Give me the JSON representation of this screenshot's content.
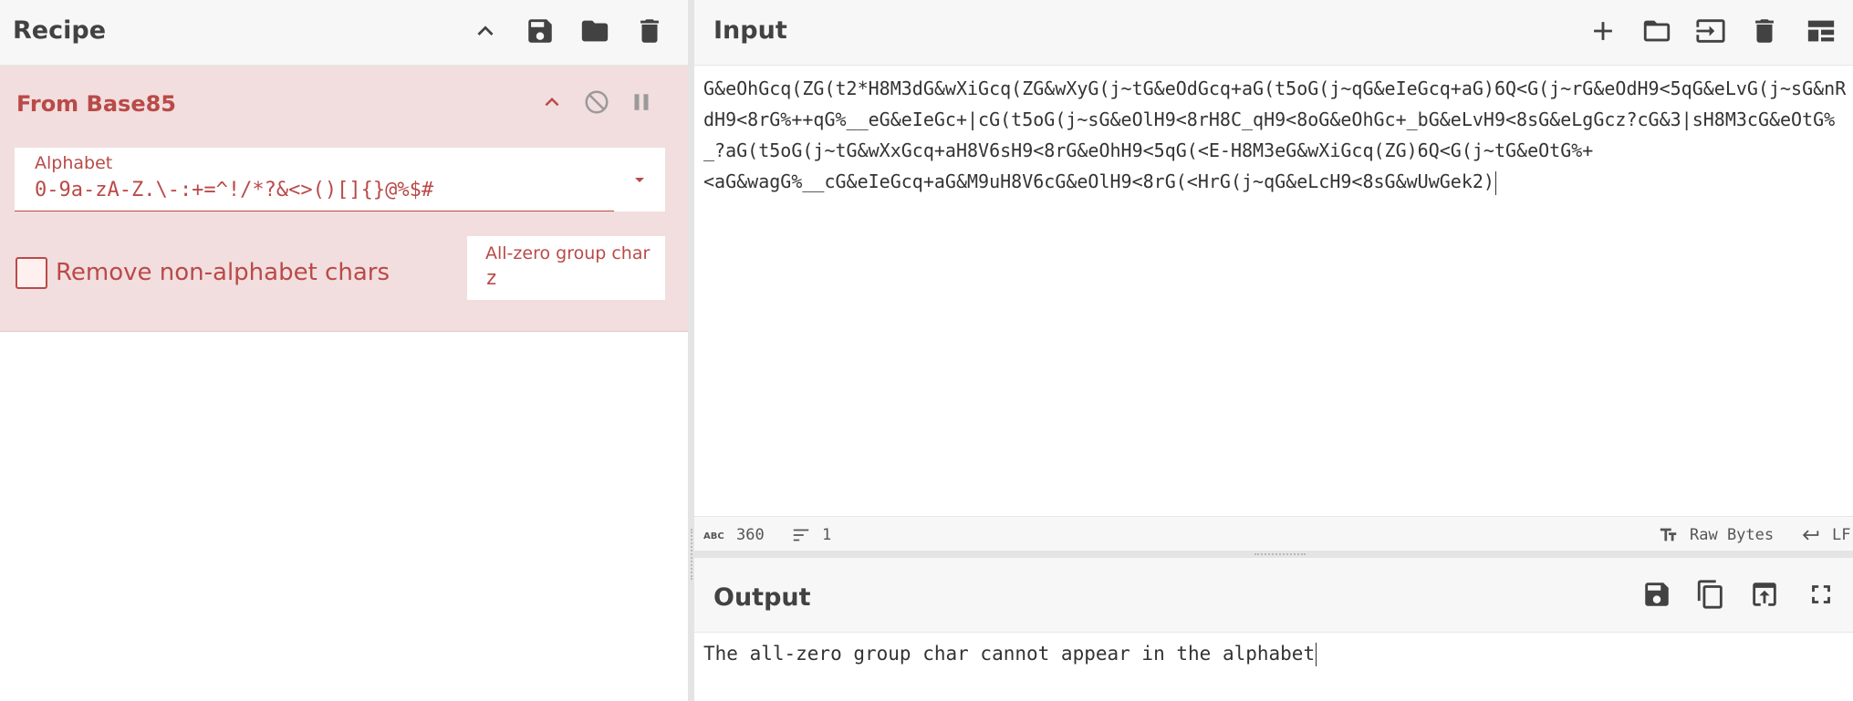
{
  "recipe": {
    "title": "Recipe",
    "operation": {
      "title": "From Base85",
      "alphabet_label": "Alphabet",
      "alphabet_value": "0-9a-zA-Z.\\-:+=^!/*?&<>()[]{}@%$#",
      "remove_non_alphabet_label": "Remove non-alphabet chars",
      "remove_non_alphabet_checked": false,
      "all_zero_label": "All-zero group char",
      "all_zero_value": "z"
    }
  },
  "input": {
    "title": "Input",
    "text": "G&eOhGcq(ZG(t2*H8M3dG&wXiGcq(ZG&wXyG(j~tG&eOdGcq+aG(t5oG(j~qG&eIeGcq+aG)6Q<G(j~rG&eOdH9<5qG&eLvG(j~sG&nRdH9<8rG%++qG%__eG&eIeGc+|cG(t5oG(j~sG&eOlH9<8rH8C_qH9<8oG&eOhGc+_bG&eLvH9<8sG&eLgGcz?cG&3|sH8M3cG&eOtG%_?aG(t5oG(j~tG&wXxGcq+aH8V6sH9<8rG&eOhH9<5qG(<E-H8M3eG&wXiGcq(ZG)6Q<G(j~tG&eOtG%+\n<aG&wagG%__cG&eIeGcq+aG&M9uH8V6cG&eOlH9<8rG(<HrG(j~qG&eLcH9<8sG&wUwGek2)",
    "status": {
      "length": "360",
      "lines": "1",
      "encoding": "Raw Bytes",
      "eol": "LF"
    }
  },
  "output": {
    "title": "Output",
    "text": "The all-zero group char cannot appear in the alphabet"
  },
  "colors": {
    "operation_bg": "#f2dede",
    "operation_accent": "#b94a48",
    "header_bg": "#f7f7f7"
  }
}
